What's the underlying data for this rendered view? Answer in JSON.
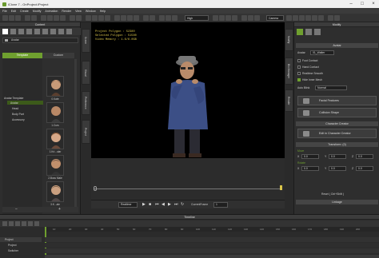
{
  "window": {
    "title": "iClone 7 - OnProject.iProject"
  },
  "menu": [
    "File",
    "Edit",
    "Create",
    "Modify",
    "Animation",
    "Render",
    "View",
    "Window",
    "Help"
  ],
  "toolbar": {
    "quality": "High",
    "camera": "Camera"
  },
  "content": {
    "title": "Content",
    "tabs": [
      "Template",
      "Custom"
    ],
    "breadcrumb": "Avatar",
    "tree": [
      "Avatar Template",
      "Avatar",
      "Head",
      "Body Part",
      "Accessory"
    ],
    "thumbs": [
      "0.Kate",
      "1.Curs",
      "1.Kri...ular",
      "2.Boss Male",
      "3.K...ale"
    ]
  },
  "side_tabs_left": [
    "Scene",
    "Visual",
    "Preference",
    "Project"
  ],
  "side_tabs_right": [
    "Modify",
    "Bio Manager",
    "Render"
  ],
  "viewport": {
    "hud": [
      "Project Polygon : 52380",
      "Selected Polygon : 51580",
      "Video Memory : 1.6/6.0GB"
    ]
  },
  "playback": {
    "realtime": "Realtime",
    "frame_label": "CurrentFrame",
    "frame": "1"
  },
  "modify": {
    "title": "Modify",
    "section_avatar": "Avatar",
    "name_label": "Avatar",
    "name_value": "01_Walter",
    "options": [
      {
        "label": "Foot Contact",
        "checked": false
      },
      {
        "label": "Hand Contact",
        "checked": false
      },
      {
        "label": "Realtime Smooth",
        "checked": false
      },
      {
        "label": "Hide Inner Mesh",
        "checked": true
      }
    ],
    "autoblink_label": "Auto Blink",
    "autoblink_value": "Normal",
    "btn_facial": "Facial Features",
    "btn_collision": "Collision Shape",
    "section_creator": "Character Creator",
    "btn_edit_cc": "Edit in Character Creator",
    "section_transform": "Transform: (0)",
    "move_label": "Move",
    "rotate_label": "Rotate",
    "xyz": [
      "X",
      "Y",
      "Z"
    ],
    "move_values": [
      "0.0",
      "0.0",
      "0.0"
    ],
    "rotate_values": [
      "0.0",
      "0.0",
      "0.0"
    ],
    "reset_label": "Reset ( Ctrl+Shift )",
    "section_linkage": "Linkage"
  },
  "timeline": {
    "title": "Timeline",
    "tracks": [
      "Project",
      "Project",
      "Switcher"
    ],
    "ruler": [
      "10",
      "20",
      "30",
      "40",
      "50",
      "60",
      "70",
      "80",
      "90",
      "100",
      "110",
      "120",
      "130",
      "140",
      "150",
      "160",
      "170",
      "180",
      "190",
      "200"
    ]
  },
  "colors": {
    "accent": "#6fa02f",
    "hud": "#d9c44a",
    "viewport_bg": "#000000"
  }
}
